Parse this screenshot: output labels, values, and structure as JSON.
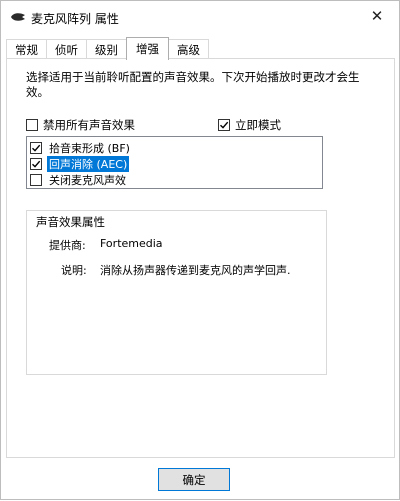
{
  "window": {
    "title": "麦克风阵列 属性",
    "close_glyph": "✕"
  },
  "tabs": [
    {
      "label": "常规"
    },
    {
      "label": "侦听"
    },
    {
      "label": "级别"
    },
    {
      "label": "增强"
    },
    {
      "label": "高级"
    }
  ],
  "active_tab": "增强",
  "enhancements": {
    "description": "选择适用于当前聆听配置的声音效果。下次开始播放时更改才会生效。",
    "disable_all": {
      "label": "禁用所有声音效果",
      "checked": false
    },
    "immediate_mode": {
      "label": "立即模式",
      "checked": true
    },
    "effects": [
      {
        "label": "拾音束形成 (BF)",
        "checked": true,
        "selected": false
      },
      {
        "label": "回声消除 (AEC)",
        "checked": true,
        "selected": true
      },
      {
        "label": "关闭麦克风声效",
        "checked": false,
        "selected": false
      }
    ],
    "properties": {
      "title": "声音效果属性",
      "provider_label": "提供商:",
      "provider_value": "Fortemedia",
      "description_label": "说明:",
      "description_value": "消除从扬声器传递到麦克风的声学回声."
    }
  },
  "buttons": {
    "ok_label": "确定"
  },
  "colors": {
    "selection": "#0078d7",
    "border": "#d9d9d9"
  }
}
